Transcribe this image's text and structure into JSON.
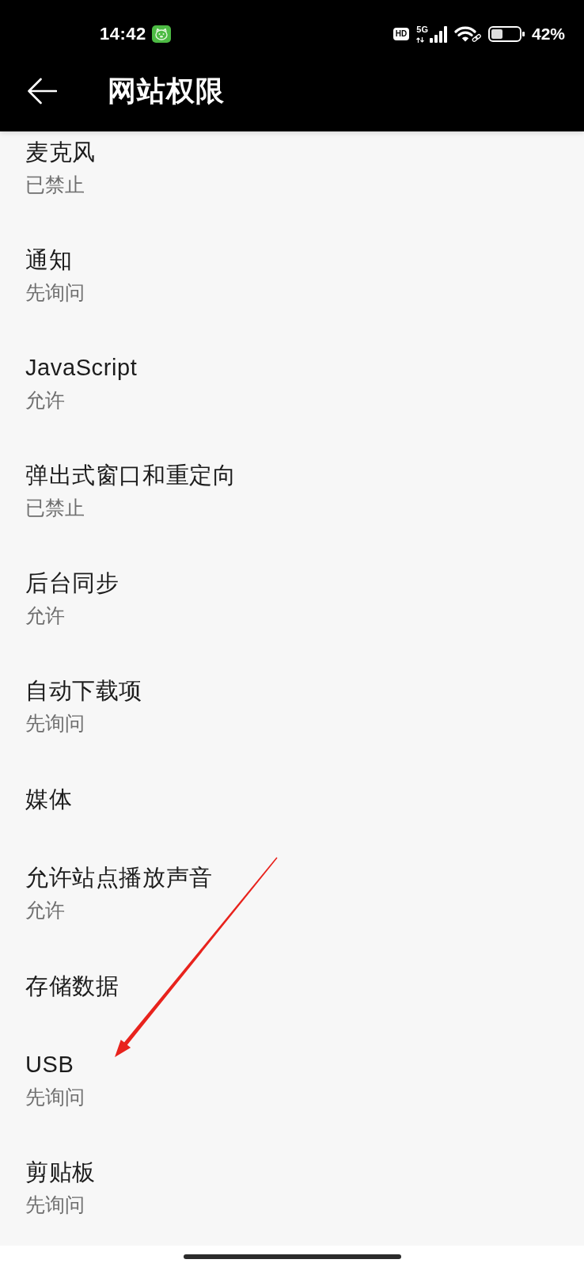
{
  "status_bar": {
    "time": "14:42",
    "hd_badge": "HD",
    "network_type": "5G",
    "battery": "42%"
  },
  "app_bar": {
    "title": "网站权限"
  },
  "permissions": [
    {
      "title": "麦克风",
      "status": "已禁止"
    },
    {
      "title": "通知",
      "status": "先询问"
    },
    {
      "title": "JavaScript",
      "status": "允许"
    },
    {
      "title": "弹出式窗口和重定向",
      "status": "已禁止"
    },
    {
      "title": "后台同步",
      "status": "允许"
    },
    {
      "title": "自动下载项",
      "status": "先询问"
    },
    {
      "title": "媒体"
    },
    {
      "title": "允许站点播放声音",
      "status": "允许"
    },
    {
      "title": "存储数据"
    },
    {
      "title": "USB",
      "status": "先询问"
    },
    {
      "title": "剪贴板",
      "status": "先询问"
    }
  ]
}
